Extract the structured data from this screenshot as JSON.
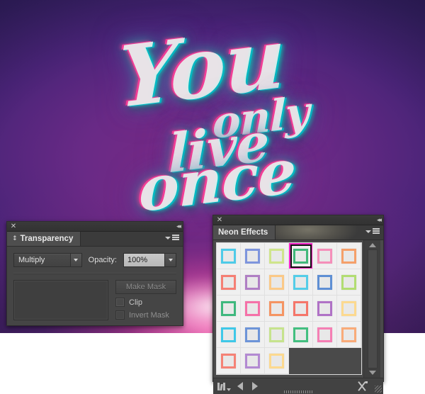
{
  "artwork": {
    "line1": "You",
    "line2": "only",
    "line3": "live",
    "line4": "once",
    "background_top_color": "#2b1f5e",
    "background_mid_color": "#7c2a86",
    "glow_color": "#ffd0e8",
    "neon_color": "#e8f0ee"
  },
  "transparency_panel": {
    "close_icon": "✕",
    "collapse_icon": "◂◂",
    "tab_label": "Transparency",
    "tab_arrows_icon": "↕",
    "blend_mode": "Multiply",
    "opacity_label": "Opacity:",
    "opacity_value": "100%",
    "make_mask_label": "Make Mask",
    "clip_label": "Clip",
    "invert_mask_label": "Invert Mask"
  },
  "neon_panel": {
    "close_icon": "✕",
    "collapse_icon": "◂◂",
    "tab_label": "Neon Effects",
    "selected_index": 3,
    "swatches": [
      {
        "color": "#4ecbe8",
        "name": "cyan"
      },
      {
        "color": "#7e95dd",
        "name": "periwinkle"
      },
      {
        "color": "#cfe58b",
        "name": "lime"
      },
      {
        "color": "#41b87a",
        "name": "green"
      },
      {
        "color": "#f58fba",
        "name": "pink"
      },
      {
        "color": "#f5a06a",
        "name": "orange"
      },
      {
        "color": "#f57f74",
        "name": "salmon"
      },
      {
        "color": "#b municipal"
      }
    ],
    "swatch_rows": [
      [
        "#4ecbe8",
        "#7e95dd",
        "#cfe58b",
        "#41b87a",
        "#f58fba",
        "#f5a06a"
      ],
      [
        "#f57f74",
        "#b07fc4",
        "#fbc987",
        "#54cde8",
        "#5f8fd4",
        "#b2dd72"
      ],
      [
        "#3fb87e",
        "#f571a8",
        "#f59462",
        "#f5766a",
        "#b072c6",
        "#fcd98f"
      ],
      [
        "#3fc8e8",
        "#6d94d8",
        "#c6e38d",
        "#43bf80",
        "#f57fb4",
        "#f9ab79"
      ],
      [
        "#f58276",
        "#b38ad2",
        "#fcd98f"
      ]
    ],
    "selection_highlight_color": "#ff22c8",
    "footer": {
      "library_icon": "symbol-libraries-icon",
      "prev_icon": "◀",
      "next_icon": "▶",
      "break_link_icon": "break-link-to-symbol-icon"
    },
    "scrollbar": {
      "up_icon": "▲",
      "down_icon": "▼"
    }
  }
}
